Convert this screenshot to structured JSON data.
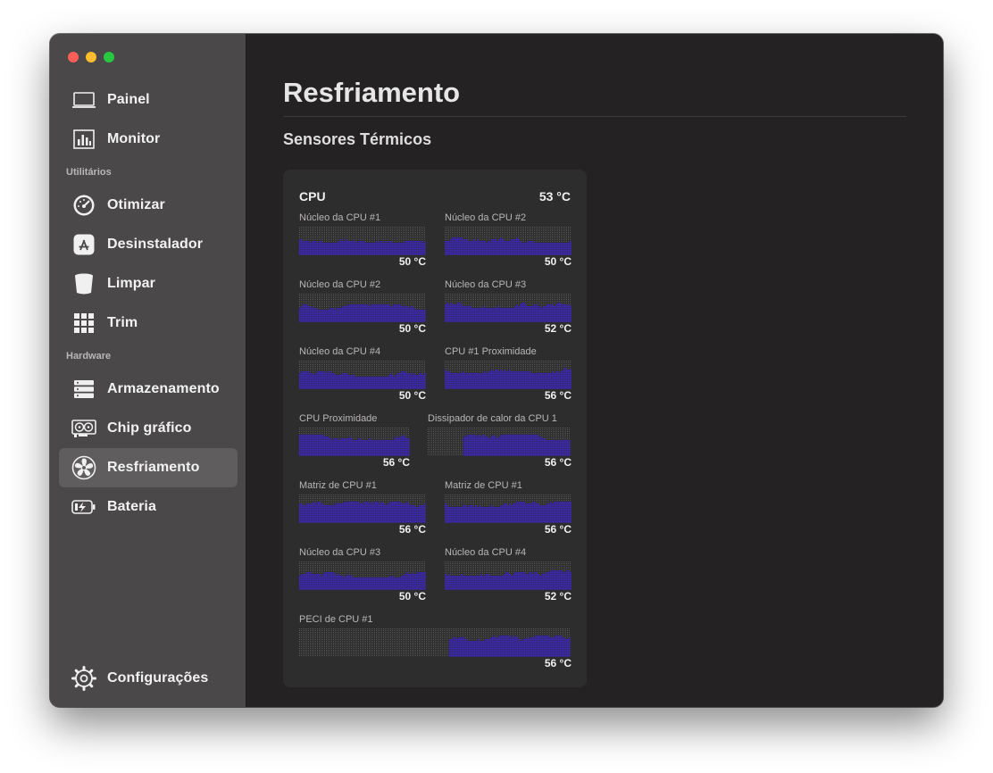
{
  "window": {
    "traffic_lights": [
      "close",
      "minimize",
      "zoom"
    ]
  },
  "sidebar": {
    "items_top": [
      {
        "label": "Painel",
        "icon": "laptop-icon"
      },
      {
        "label": "Monitor",
        "icon": "bar-chart-icon"
      }
    ],
    "section_utilities": "Utilitários",
    "items_utilities": [
      {
        "label": "Otimizar",
        "icon": "gauge-icon"
      },
      {
        "label": "Desinstalador",
        "icon": "app-store-icon"
      },
      {
        "label": "Limpar",
        "icon": "trash-bin-icon"
      },
      {
        "label": "Trim",
        "icon": "grid-icon"
      }
    ],
    "section_hardware": "Hardware",
    "items_hardware": [
      {
        "label": "Armazenamento",
        "icon": "storage-icon"
      },
      {
        "label": "Chip gráfico",
        "icon": "graphics-card-icon"
      },
      {
        "label": "Resfriamento",
        "icon": "fan-icon",
        "active": true
      },
      {
        "label": "Bateria",
        "icon": "battery-icon"
      }
    ],
    "settings": {
      "label": "Configurações",
      "icon": "gear-icon"
    }
  },
  "main": {
    "title": "Resfriamento",
    "section_title": "Sensores Térmicos",
    "card": {
      "title": "CPU",
      "temp": "53 °C",
      "sensors": [
        {
          "name": "Núcleo da CPU #1",
          "value": "50 °C"
        },
        {
          "name": "Núcleo da CPU #2",
          "value": "50 °C"
        },
        {
          "name": "Núcleo da CPU #2",
          "value": "50 °C"
        },
        {
          "name": "Núcleo da CPU #3",
          "value": "52 °C"
        },
        {
          "name": "Núcleo da CPU #4",
          "value": "50 °C"
        },
        {
          "name": "CPU #1 Proximidade",
          "value": "56 °C"
        },
        {
          "name": "CPU Proximidade",
          "value": "56 °C"
        },
        {
          "name": "Dissipador de calor da CPU 1",
          "value": "56 °C"
        },
        {
          "name": "Matriz de CPU #1",
          "value": "56 °C"
        },
        {
          "name": "Matriz de CPU #1",
          "value": "56 °C"
        },
        {
          "name": "Núcleo da CPU #3",
          "value": "50 °C"
        },
        {
          "name": "Núcleo da CPU #4",
          "value": "52 °C"
        },
        {
          "name": "PECI de CPU #1",
          "value": "56 °C"
        }
      ]
    }
  },
  "colors": {
    "graph_fill": "#3e27c9",
    "graph_empty": "#575555",
    "sidebar_bg": "#4a4848",
    "main_bg": "#242222",
    "card_bg": "#2e2d2d"
  }
}
